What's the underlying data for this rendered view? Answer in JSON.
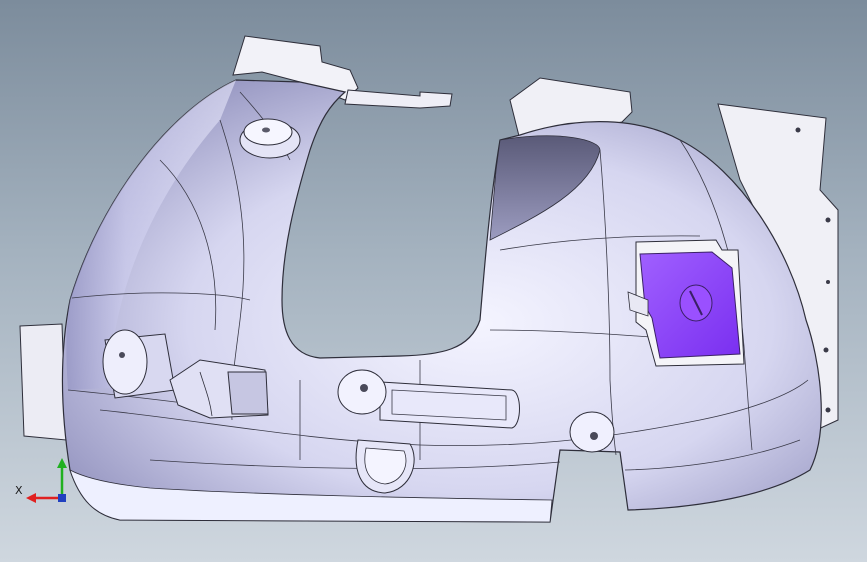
{
  "viewport": {
    "background_top": "#7c8c9c",
    "background_bottom": "#cfd7df"
  },
  "model": {
    "surface_color": "#dcdcf2",
    "edge_color": "#2e2e3a",
    "highlight_color": "#8e36ff"
  },
  "triad": {
    "x_label": "X",
    "x_color": "#e02020",
    "y_color": "#20b020"
  }
}
